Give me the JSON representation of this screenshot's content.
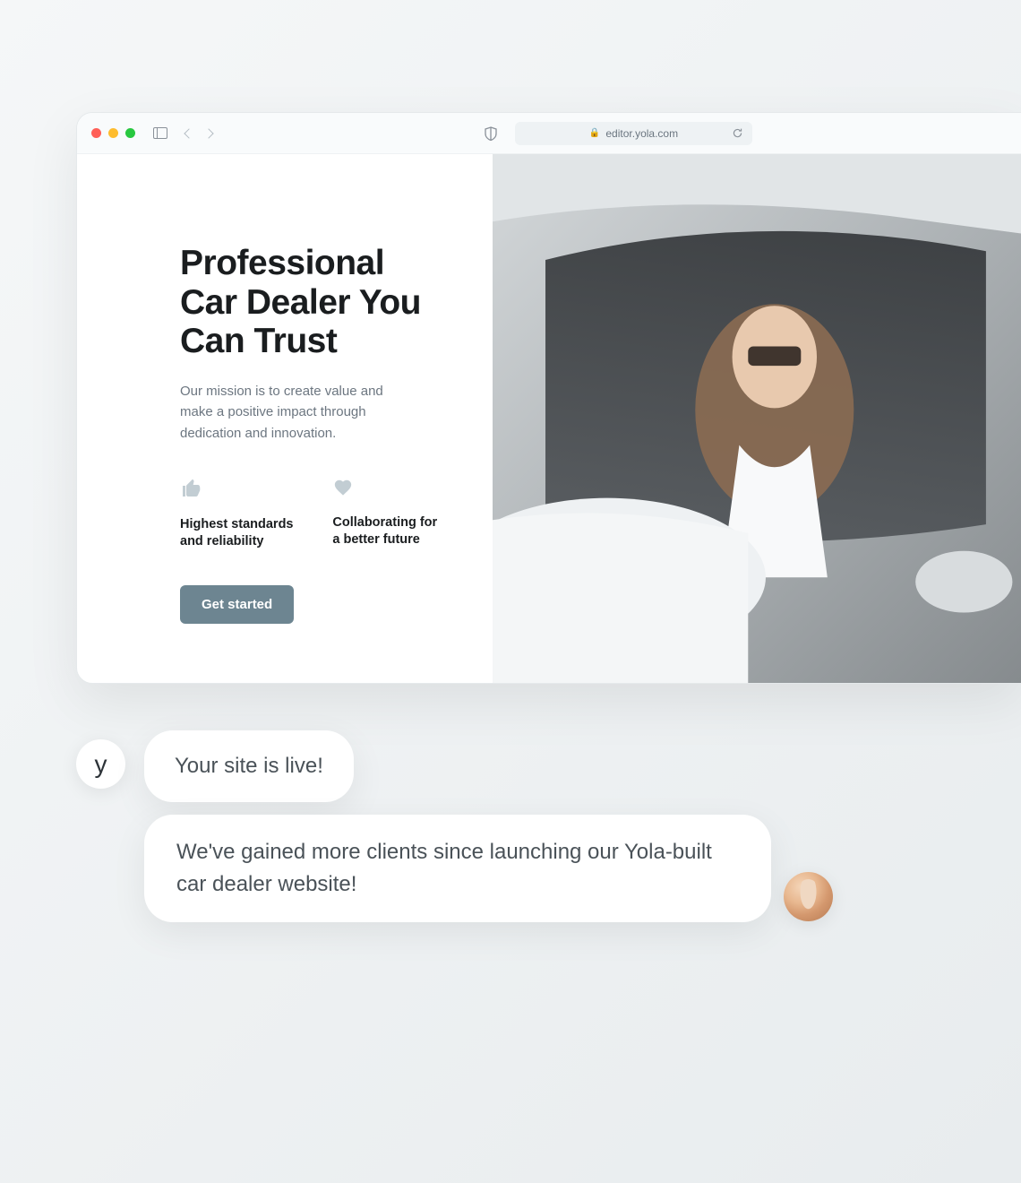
{
  "browser": {
    "url_host": "editor.yola.com"
  },
  "hero": {
    "title": "Professional Car Dealer You Can Trust",
    "subtitle": "Our mission is to create value and make a positive impact through dedication and innovation.",
    "features": [
      {
        "icon": "thumb-up",
        "label": "Highest standards and reliability"
      },
      {
        "icon": "heart",
        "label": "Collaborating for a better future"
      }
    ],
    "cta_label": "Get started"
  },
  "chat": {
    "brand_letter": "y",
    "messages": [
      {
        "role": "brand",
        "text": "Your site is live!"
      },
      {
        "role": "user",
        "text": "We've gained more clients since launching our Yola-built car dealer website!"
      }
    ]
  },
  "colors": {
    "accent": "#6d8591",
    "icon_muted": "#c2cdd3",
    "text_primary": "#1a1d1f",
    "text_secondary": "#6c7680"
  }
}
